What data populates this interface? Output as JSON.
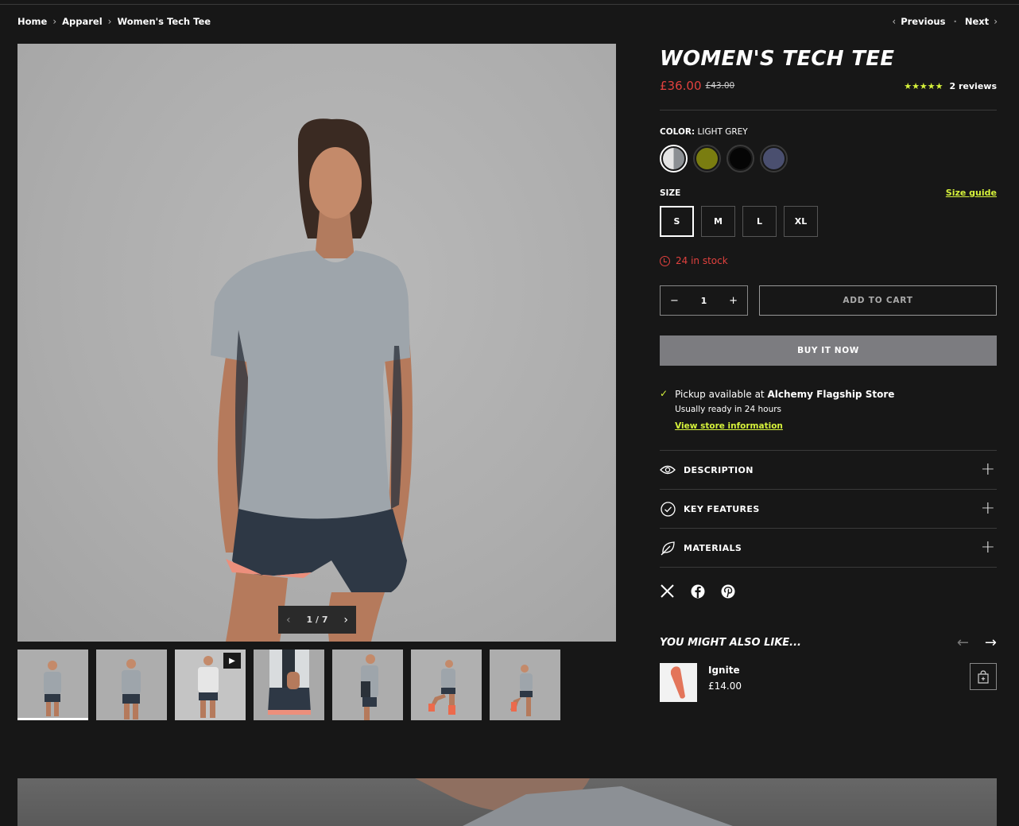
{
  "breadcrumb": {
    "items": [
      "Home",
      "Apparel",
      "Women's Tech Tee"
    ],
    "separator": ">"
  },
  "pager": {
    "previous": "Previous",
    "next": "Next",
    "dot": "·"
  },
  "gallery": {
    "counter": "1 / 7",
    "thumb_count": 7,
    "video_thumb_index": 2
  },
  "product": {
    "title": "WOMEN'S TECH TEE",
    "price": "£36.00",
    "compare_price": "£43.00",
    "rating_stars": "★★★★★",
    "rating": 4.5,
    "reviews": "2 reviews"
  },
  "color": {
    "label": "COLOR:",
    "selected": "LIGHT GREY",
    "swatches": [
      {
        "name": "Light Grey",
        "color": "#e4e4e4",
        "color2": "#8b8f93"
      },
      {
        "name": "Olive",
        "color": "#7a7d10"
      },
      {
        "name": "Black",
        "color": "#050505"
      },
      {
        "name": "Navy",
        "color": "#4a4f6f"
      }
    ]
  },
  "size": {
    "label": "SIZE",
    "guide": "Size guide",
    "options": [
      "S",
      "M",
      "L",
      "XL"
    ],
    "selected": "S"
  },
  "stock": "24 in stock",
  "cart": {
    "minus": "−",
    "quantity": "1",
    "plus": "+",
    "add_to_cart": "ADD TO CART",
    "buy_now": "BUY IT NOW"
  },
  "pickup": {
    "prefix": "Pickup available at ",
    "store": "Alchemy Flagship Store",
    "ready": "Usually ready in 24 hours",
    "link": "View store information"
  },
  "accordion": [
    {
      "label": "DESCRIPTION",
      "icon": "eye-icon"
    },
    {
      "label": "KEY FEATURES",
      "icon": "check-circle-icon"
    },
    {
      "label": "MATERIALS",
      "icon": "leaf-icon"
    }
  ],
  "social": [
    "x-icon",
    "facebook-icon",
    "pinterest-icon"
  ],
  "recommendations": {
    "title": "YOU MIGHT ALSO LIKE...",
    "items": [
      {
        "name": "Ignite",
        "price": "£14.00"
      }
    ]
  },
  "colors": {
    "accent": "#d6f23b",
    "sale": "#e1413e",
    "background": "#171717"
  }
}
